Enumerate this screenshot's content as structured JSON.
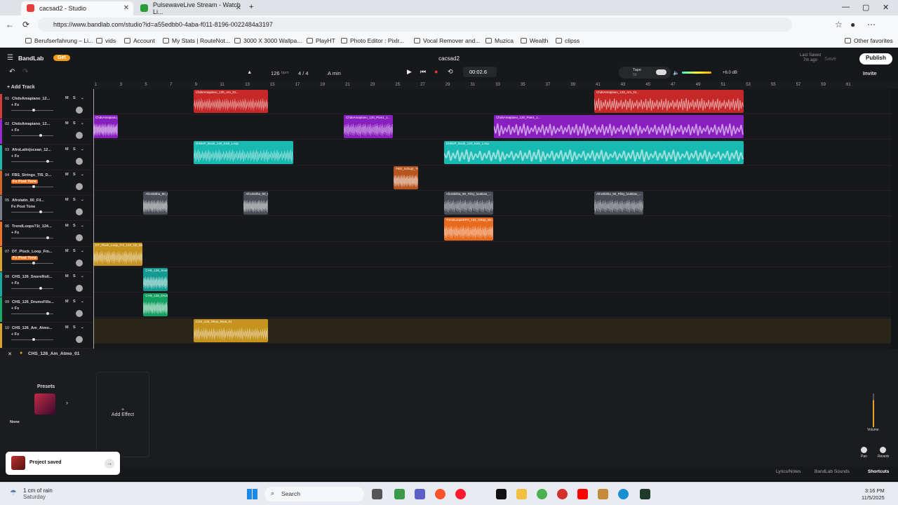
{
  "browser": {
    "tabs": [
      {
        "title": "cacsad2 - Studio",
        "fav_color": "#e83a3a"
      },
      {
        "title": "PulsewaveLive Stream - Watch Li...",
        "fav_color": "#2a9d3a"
      }
    ],
    "url": "https://www.bandlab.com/studio?id=a55edbb0-4aba-f011-8196-0022484a3197",
    "bookmarks": [
      "Berufserfahrung – Li...",
      "vids",
      "Account",
      "My Stats | RouteNot...",
      "3000 X 3000 Wallpa...",
      "PlayHT",
      "Photo Editor : Pixlr...",
      "Vocal Remover and...",
      "Muzica",
      "Wealth",
      "clipss"
    ],
    "other_favorites": "Other favorites"
  },
  "app": {
    "logo": "BandLab",
    "get": "Get",
    "project_title": "cacsad2",
    "last_saved_label": "Last Saved",
    "last_saved_value": "7m ago",
    "save": "Save",
    "publish": "Publish",
    "invite": "Invite",
    "bpm": "126",
    "bpm_unit": "bpm",
    "time_sig": "4 / 4",
    "key": "A min",
    "time": "00:02.6",
    "tape_label": "Tape",
    "tape_value": "50",
    "master_db": "+6.0 dB",
    "add_track": "Add Track"
  },
  "ruler": [
    "1",
    "3",
    "5",
    "7",
    "9",
    "11",
    "13",
    "15",
    "17",
    "19",
    "21",
    "23",
    "25",
    "27",
    "29",
    "31",
    "33",
    "35",
    "37",
    "39",
    "41",
    "43",
    "45",
    "47",
    "49",
    "51",
    "53",
    "55",
    "57",
    "59",
    "61"
  ],
  "tracks": [
    {
      "num": "01",
      "name": "ChdsAmapiano_12...",
      "fx": "+ Fx",
      "tone": false,
      "color": "#d63a3a"
    },
    {
      "num": "02",
      "name": "ChdsAmapiano_12...",
      "fx": "+ Fx",
      "tone": false,
      "color": "#9b2ad0"
    },
    {
      "num": "03",
      "name": "AfroLatin(ocean_12...",
      "fx": "+ Fx",
      "tone": false,
      "color": "#1fb8b0"
    },
    {
      "num": "04",
      "name": "FBS_Strings_TIS_D...",
      "fx": "Fx Post Tone",
      "tone": true,
      "color": "#d2662a"
    },
    {
      "num": "05",
      "name": "Afrolatin_90_Fil...",
      "fx": "Fx Post Tone",
      "tone": false,
      "color": "#7a7d85"
    },
    {
      "num": "06",
      "name": "TrendLoops?1t_124...",
      "fx": "+ Fx",
      "tone": false,
      "color": "#f0722a"
    },
    {
      "num": "07",
      "name": "DT_Pluck_Loop_Fm...",
      "fx": "Fx Post Tone",
      "tone": true,
      "color": "#d8a42a"
    },
    {
      "num": "08",
      "name": "CHS_126_SnoreRoll...",
      "fx": "+ Fx",
      "tone": false,
      "color": "#18a8a0"
    },
    {
      "num": "09",
      "name": "CHS_126_DrumsFills...",
      "fx": "+ Fx",
      "tone": false,
      "color": "#1aa868"
    },
    {
      "num": "10",
      "name": "CHS_126_Am_Atmo...",
      "fx": "+ Fx",
      "tone": false,
      "color": "#d8a42a"
    }
  ],
  "clips": [
    {
      "lane": 0,
      "start": 9,
      "len": 6,
      "label": "ChdsAmapiano_120_Am_Dr...",
      "color": "#c62828"
    },
    {
      "lane": 0,
      "start": 41,
      "len": 12,
      "label": "ChdsAmapiano_120_Am_Dr...",
      "color": "#c62828"
    },
    {
      "lane": 1,
      "start": 1,
      "len": 2,
      "label": "ChdsAmapiano_120_Pian1_1...",
      "color": "#8a1fc0"
    },
    {
      "lane": 1,
      "start": 21,
      "len": 4,
      "label": "ChdsAmapiano_120_Pian1_1...",
      "color": "#8a1fc0"
    },
    {
      "lane": 1,
      "start": 33,
      "len": 20,
      "label": "ChdsAmapiano_120_Pian1_1...",
      "color": "#8a1fc0"
    },
    {
      "lane": 2,
      "start": 9,
      "len": 8,
      "label": "DHBsP_Book_120_Kick_Loop",
      "color": "#18b9b0"
    },
    {
      "lane": 2,
      "start": 29,
      "len": 24,
      "label": "DHBsP_Book_120_Kick_Loop",
      "color": "#18b9b0"
    },
    {
      "lane": 3,
      "start": 25,
      "len": 2,
      "label": "FBS_Schuyt_TIS_CFm_Liner",
      "color": "#b8541e"
    },
    {
      "lane": 4,
      "start": 5,
      "len": 2,
      "label": "AfroSkitha_90_Filtry_looBras_...",
      "color": "#4a4d55"
    },
    {
      "lane": 4,
      "start": 13,
      "len": 2,
      "label": "AfroSkitha_90_Filtry_looBras_...",
      "color": "#4a4d55"
    },
    {
      "lane": 4,
      "start": 29,
      "len": 4,
      "label": "AfroSkitha_90_Filtry_looBras_...",
      "color": "#4a4d55"
    },
    {
      "lane": 4,
      "start": 41,
      "len": 4,
      "label": "AfroSkitha_90_Filtry_looBras_...",
      "color": "#4a4d55"
    },
    {
      "lane": 5,
      "start": 29,
      "len": 4,
      "label": "TrendLoopsEFH_124_GBop_Be...",
      "color": "#e86a1e"
    },
    {
      "lane": 6,
      "start": 1,
      "len": 4,
      "label": "DT_Pluck_Loop_Fm_120_Gb_Birnd",
      "color": "#c6931e"
    },
    {
      "lane": 7,
      "start": 5,
      "len": 2,
      "label": "CHS_126_SnoreRoll_01",
      "color": "#139a92"
    },
    {
      "lane": 8,
      "start": 5,
      "len": 2,
      "label": "CHS_126_DrumsFills_01",
      "color": "#13a060"
    },
    {
      "lane": 9,
      "start": 9,
      "len": 6,
      "label": "CHS_126_Shou_Beat_01",
      "color": "#c6931e"
    }
  ],
  "effects": {
    "track_name": "CHS_126_Am_Atmo_01",
    "presets": "Presets",
    "preset_value": "None",
    "add_effect": "Add Effect",
    "volume": "Volume",
    "pan": "Pan",
    "reverb": "Reverb"
  },
  "toast": "Project saved",
  "footer": [
    "Lyrics/Notes",
    "BandLab Sounds",
    "Shortcuts"
  ],
  "taskbar": {
    "weather_1": "1 cm of rain",
    "weather_2": "Saturday",
    "search": "Search",
    "time": "3:16 PM",
    "date": "11/5/2025"
  }
}
